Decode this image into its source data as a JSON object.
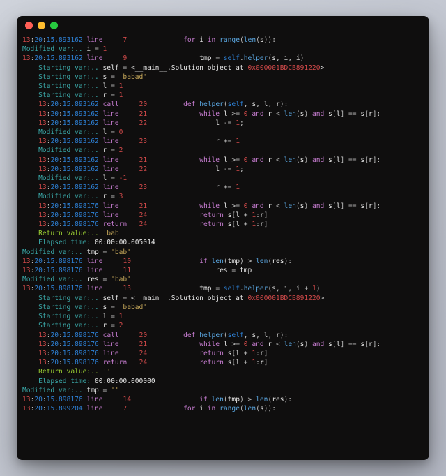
{
  "window": {
    "title": ""
  },
  "colors": {
    "bg": "#0f0e0e",
    "titlebar_red": "#ff5f56",
    "titlebar_yellow": "#ffbd2e",
    "titlebar_green": "#27c93f"
  },
  "trace": [
    {
      "kind": "event",
      "ts": "13:20:15.893162",
      "ev": "line",
      "lineno": 7,
      "indent": 0,
      "code": {
        "tok": [
          [
            "kw",
            "for "
          ],
          [
            "wht",
            "i "
          ],
          [
            "kw",
            "in "
          ],
          [
            "fn",
            "range"
          ],
          [
            "op",
            "("
          ],
          [
            "fn",
            "len"
          ],
          [
            "op",
            "("
          ],
          [
            "wht",
            "s"
          ],
          [
            "op",
            ")):"
          ]
        ]
      }
    },
    {
      "kind": "mod",
      "indent": 0,
      "text": "Modified var:.. i = 1"
    },
    {
      "kind": "event",
      "ts": "13:20:15.893162",
      "ev": "line",
      "lineno": 9,
      "indent": 0,
      "code": {
        "tok": [
          [
            "wht",
            "tmp "
          ],
          [
            "op",
            "= "
          ],
          [
            "builtin",
            "self"
          ],
          [
            "op",
            "."
          ],
          [
            "fn",
            "helper"
          ],
          [
            "op",
            "("
          ],
          [
            "wht",
            "s"
          ],
          [
            "op",
            ", "
          ],
          [
            "wht",
            "i"
          ],
          [
            "op",
            ", "
          ],
          [
            "wht",
            "i"
          ],
          [
            "op",
            ")"
          ]
        ]
      }
    },
    {
      "kind": "start",
      "indent": 1,
      "text": "Starting var:.. self = <__main__.Solution object at 0x000001BDCB891220>"
    },
    {
      "kind": "start",
      "indent": 1,
      "text": "Starting var:.. s = 'babad'"
    },
    {
      "kind": "start",
      "indent": 1,
      "text": "Starting var:.. l = 1"
    },
    {
      "kind": "start",
      "indent": 1,
      "text": "Starting var:.. r = 1"
    },
    {
      "kind": "event",
      "ts": "13:20:15.893162",
      "ev": "call",
      "lineno": 20,
      "indent": 1,
      "code": {
        "tok": [
          [
            "kw",
            "def "
          ],
          [
            "fn",
            "helper"
          ],
          [
            "op",
            "("
          ],
          [
            "builtin",
            "self"
          ],
          [
            "op",
            ", "
          ],
          [
            "wht",
            "s"
          ],
          [
            "op",
            ", "
          ],
          [
            "wht",
            "l"
          ],
          [
            "op",
            ", "
          ],
          [
            "wht",
            "r"
          ],
          [
            "op",
            "):"
          ]
        ]
      }
    },
    {
      "kind": "event",
      "ts": "13:20:15.893162",
      "ev": "line",
      "lineno": 21,
      "indent": 1,
      "code": {
        "tok": [
          [
            "kw",
            "while "
          ],
          [
            "wht",
            "l "
          ],
          [
            "op",
            ">= "
          ],
          [
            "num",
            "0"
          ],
          [
            "op",
            " "
          ],
          [
            "kw",
            "and "
          ],
          [
            "wht",
            "r "
          ],
          [
            "op",
            "< "
          ],
          [
            "fn",
            "len"
          ],
          [
            "op",
            "("
          ],
          [
            "wht",
            "s"
          ],
          [
            "op",
            ") "
          ],
          [
            "kw",
            "and "
          ],
          [
            "wht",
            "s"
          ],
          [
            "op",
            "["
          ],
          [
            "wht",
            "l"
          ],
          [
            "op",
            "] == "
          ],
          [
            "wht",
            "s"
          ],
          [
            "op",
            "["
          ],
          [
            "wht",
            "r"
          ],
          [
            "op",
            "]:"
          ]
        ]
      }
    },
    {
      "kind": "event",
      "ts": "13:20:15.893162",
      "ev": "line",
      "lineno": 22,
      "indent": 1,
      "code": {
        "tok": [
          [
            "wht",
            "l "
          ],
          [
            "op",
            "-= "
          ],
          [
            "num",
            "1"
          ],
          [
            "op",
            ";"
          ]
        ]
      }
    },
    {
      "kind": "mod",
      "indent": 1,
      "text": "Modified var:.. l = 0"
    },
    {
      "kind": "event",
      "ts": "13:20:15.893162",
      "ev": "line",
      "lineno": 23,
      "indent": 1,
      "code": {
        "tok": [
          [
            "wht",
            "r "
          ],
          [
            "op",
            "+= "
          ],
          [
            "num",
            "1"
          ]
        ]
      }
    },
    {
      "kind": "mod",
      "indent": 1,
      "text": "Modified var:.. r = 2"
    },
    {
      "kind": "event",
      "ts": "13:20:15.893162",
      "ev": "line",
      "lineno": 21,
      "indent": 1,
      "code": {
        "tok": [
          [
            "kw",
            "while "
          ],
          [
            "wht",
            "l "
          ],
          [
            "op",
            ">= "
          ],
          [
            "num",
            "0"
          ],
          [
            "op",
            " "
          ],
          [
            "kw",
            "and "
          ],
          [
            "wht",
            "r "
          ],
          [
            "op",
            "< "
          ],
          [
            "fn",
            "len"
          ],
          [
            "op",
            "("
          ],
          [
            "wht",
            "s"
          ],
          [
            "op",
            ") "
          ],
          [
            "kw",
            "and "
          ],
          [
            "wht",
            "s"
          ],
          [
            "op",
            "["
          ],
          [
            "wht",
            "l"
          ],
          [
            "op",
            "] == "
          ],
          [
            "wht",
            "s"
          ],
          [
            "op",
            "["
          ],
          [
            "wht",
            "r"
          ],
          [
            "op",
            "]:"
          ]
        ]
      }
    },
    {
      "kind": "event",
      "ts": "13:20:15.893162",
      "ev": "line",
      "lineno": 22,
      "indent": 1,
      "code": {
        "tok": [
          [
            "wht",
            "l "
          ],
          [
            "op",
            "-= "
          ],
          [
            "num",
            "1"
          ],
          [
            "op",
            ";"
          ]
        ]
      }
    },
    {
      "kind": "mod",
      "indent": 1,
      "text": "Modified var:.. l = -1"
    },
    {
      "kind": "event",
      "ts": "13:20:15.893162",
      "ev": "line",
      "lineno": 23,
      "indent": 1,
      "code": {
        "tok": [
          [
            "wht",
            "r "
          ],
          [
            "op",
            "+= "
          ],
          [
            "num",
            "1"
          ]
        ]
      }
    },
    {
      "kind": "mod",
      "indent": 1,
      "text": "Modified var:.. r = 3"
    },
    {
      "kind": "event",
      "ts": "13:20:15.898176",
      "ev": "line",
      "lineno": 21,
      "indent": 1,
      "code": {
        "tok": [
          [
            "kw",
            "while "
          ],
          [
            "wht",
            "l "
          ],
          [
            "op",
            ">= "
          ],
          [
            "num",
            "0"
          ],
          [
            "op",
            " "
          ],
          [
            "kw",
            "and "
          ],
          [
            "wht",
            "r "
          ],
          [
            "op",
            "< "
          ],
          [
            "fn",
            "len"
          ],
          [
            "op",
            "("
          ],
          [
            "wht",
            "s"
          ],
          [
            "op",
            ") "
          ],
          [
            "kw",
            "and "
          ],
          [
            "wht",
            "s"
          ],
          [
            "op",
            "["
          ],
          [
            "wht",
            "l"
          ],
          [
            "op",
            "] == "
          ],
          [
            "wht",
            "s"
          ],
          [
            "op",
            "["
          ],
          [
            "wht",
            "r"
          ],
          [
            "op",
            "]:"
          ]
        ]
      }
    },
    {
      "kind": "event",
      "ts": "13:20:15.898176",
      "ev": "line",
      "lineno": 24,
      "indent": 1,
      "code": {
        "tok": [
          [
            "kw",
            "return "
          ],
          [
            "wht",
            "s"
          ],
          [
            "op",
            "["
          ],
          [
            "wht",
            "l "
          ],
          [
            "op",
            "+ "
          ],
          [
            "num",
            "1"
          ],
          [
            "op",
            ":"
          ],
          [
            "wht",
            "r"
          ],
          [
            "op",
            "]"
          ]
        ]
      }
    },
    {
      "kind": "event",
      "ts": "13:20:15.898176",
      "ev": "return",
      "lineno": 24,
      "indent": 1,
      "code": {
        "tok": [
          [
            "kw",
            "return "
          ],
          [
            "wht",
            "s"
          ],
          [
            "op",
            "["
          ],
          [
            "wht",
            "l "
          ],
          [
            "op",
            "+ "
          ],
          [
            "num",
            "1"
          ],
          [
            "op",
            ":"
          ],
          [
            "wht",
            "r"
          ],
          [
            "op",
            "]"
          ]
        ]
      }
    },
    {
      "kind": "ret",
      "indent": 1,
      "text": "Return value:.. 'bab'"
    },
    {
      "kind": "elapsed",
      "indent": 1,
      "text": "Elapsed time: 00:00:00.005014"
    },
    {
      "kind": "mod",
      "indent": 0,
      "text": "Modified var:.. tmp = 'bab'"
    },
    {
      "kind": "event",
      "ts": "13:20:15.898176",
      "ev": "line",
      "lineno": 10,
      "indent": 0,
      "code": {
        "tok": [
          [
            "kw",
            "if "
          ],
          [
            "fn",
            "len"
          ],
          [
            "op",
            "("
          ],
          [
            "wht",
            "tmp"
          ],
          [
            "op",
            ") > "
          ],
          [
            "fn",
            "len"
          ],
          [
            "op",
            "("
          ],
          [
            "wht",
            "res"
          ],
          [
            "op",
            "):"
          ]
        ]
      }
    },
    {
      "kind": "event",
      "ts": "13:20:15.898176",
      "ev": "line",
      "lineno": 11,
      "indent": 0,
      "code": {
        "tok": [
          [
            "wht",
            "res "
          ],
          [
            "op",
            "= "
          ],
          [
            "wht",
            "tmp"
          ]
        ]
      }
    },
    {
      "kind": "mod",
      "indent": 0,
      "text": "Modified var:.. res = 'bab'"
    },
    {
      "kind": "event",
      "ts": "13:20:15.898176",
      "ev": "line",
      "lineno": 13,
      "indent": 0,
      "code": {
        "tok": [
          [
            "wht",
            "tmp "
          ],
          [
            "op",
            "= "
          ],
          [
            "builtin",
            "self"
          ],
          [
            "op",
            "."
          ],
          [
            "fn",
            "helper"
          ],
          [
            "op",
            "("
          ],
          [
            "wht",
            "s"
          ],
          [
            "op",
            ", "
          ],
          [
            "wht",
            "i"
          ],
          [
            "op",
            ", "
          ],
          [
            "wht",
            "i "
          ],
          [
            "op",
            "+ "
          ],
          [
            "num",
            "1"
          ],
          [
            "op",
            ")"
          ]
        ]
      }
    },
    {
      "kind": "start",
      "indent": 1,
      "text": "Starting var:.. self = <__main__.Solution object at 0x000001BDCB891220>"
    },
    {
      "kind": "start",
      "indent": 1,
      "text": "Starting var:.. s = 'babad'"
    },
    {
      "kind": "start",
      "indent": 1,
      "text": "Starting var:.. l = 1"
    },
    {
      "kind": "start",
      "indent": 1,
      "text": "Starting var:.. r = 2"
    },
    {
      "kind": "event",
      "ts": "13:20:15.898176",
      "ev": "call",
      "lineno": 20,
      "indent": 1,
      "code": {
        "tok": [
          [
            "kw",
            "def "
          ],
          [
            "fn",
            "helper"
          ],
          [
            "op",
            "("
          ],
          [
            "builtin",
            "self"
          ],
          [
            "op",
            ", "
          ],
          [
            "wht",
            "s"
          ],
          [
            "op",
            ", "
          ],
          [
            "wht",
            "l"
          ],
          [
            "op",
            ", "
          ],
          [
            "wht",
            "r"
          ],
          [
            "op",
            "):"
          ]
        ]
      }
    },
    {
      "kind": "event",
      "ts": "13:20:15.898176",
      "ev": "line",
      "lineno": 21,
      "indent": 1,
      "code": {
        "tok": [
          [
            "kw",
            "while "
          ],
          [
            "wht",
            "l "
          ],
          [
            "op",
            ">= "
          ],
          [
            "num",
            "0"
          ],
          [
            "op",
            " "
          ],
          [
            "kw",
            "and "
          ],
          [
            "wht",
            "r "
          ],
          [
            "op",
            "< "
          ],
          [
            "fn",
            "len"
          ],
          [
            "op",
            "("
          ],
          [
            "wht",
            "s"
          ],
          [
            "op",
            ") "
          ],
          [
            "kw",
            "and "
          ],
          [
            "wht",
            "s"
          ],
          [
            "op",
            "["
          ],
          [
            "wht",
            "l"
          ],
          [
            "op",
            "] == "
          ],
          [
            "wht",
            "s"
          ],
          [
            "op",
            "["
          ],
          [
            "wht",
            "r"
          ],
          [
            "op",
            "]:"
          ]
        ]
      }
    },
    {
      "kind": "event",
      "ts": "13:20:15.898176",
      "ev": "line",
      "lineno": 24,
      "indent": 1,
      "code": {
        "tok": [
          [
            "kw",
            "return "
          ],
          [
            "wht",
            "s"
          ],
          [
            "op",
            "["
          ],
          [
            "wht",
            "l "
          ],
          [
            "op",
            "+ "
          ],
          [
            "num",
            "1"
          ],
          [
            "op",
            ":"
          ],
          [
            "wht",
            "r"
          ],
          [
            "op",
            "]"
          ]
        ]
      }
    },
    {
      "kind": "event",
      "ts": "13:20:15.898176",
      "ev": "return",
      "lineno": 24,
      "indent": 1,
      "code": {
        "tok": [
          [
            "kw",
            "return "
          ],
          [
            "wht",
            "s"
          ],
          [
            "op",
            "["
          ],
          [
            "wht",
            "l "
          ],
          [
            "op",
            "+ "
          ],
          [
            "num",
            "1"
          ],
          [
            "op",
            ":"
          ],
          [
            "wht",
            "r"
          ],
          [
            "op",
            "]"
          ]
        ]
      }
    },
    {
      "kind": "ret",
      "indent": 1,
      "text": "Return value:.. ''"
    },
    {
      "kind": "elapsed",
      "indent": 1,
      "text": "Elapsed time: 00:00:00.000000"
    },
    {
      "kind": "mod",
      "indent": 0,
      "text": "Modified var:.. tmp = ''"
    },
    {
      "kind": "event",
      "ts": "13:20:15.898176",
      "ev": "line",
      "lineno": 14,
      "indent": 0,
      "code": {
        "tok": [
          [
            "kw",
            "if "
          ],
          [
            "fn",
            "len"
          ],
          [
            "op",
            "("
          ],
          [
            "wht",
            "tmp"
          ],
          [
            "op",
            ") > "
          ],
          [
            "fn",
            "len"
          ],
          [
            "op",
            "("
          ],
          [
            "wht",
            "res"
          ],
          [
            "op",
            "):"
          ]
        ]
      }
    },
    {
      "kind": "event",
      "ts": "13:20:15.899204",
      "ev": "line",
      "lineno": 7,
      "indent": 0,
      "code": {
        "tok": [
          [
            "kw",
            "for "
          ],
          [
            "wht",
            "i "
          ],
          [
            "kw",
            "in "
          ],
          [
            "fn",
            "range"
          ],
          [
            "op",
            "("
          ],
          [
            "fn",
            "len"
          ],
          [
            "op",
            "("
          ],
          [
            "wht",
            "s"
          ],
          [
            "op",
            ")):"
          ]
        ]
      }
    }
  ],
  "code_base_indent": {
    "7": 2,
    "9": 3,
    "10": 3,
    "11": 4,
    "13": 3,
    "14": 3,
    "20": 1,
    "21": 2,
    "22": 3,
    "23": 3,
    "24": 2
  }
}
